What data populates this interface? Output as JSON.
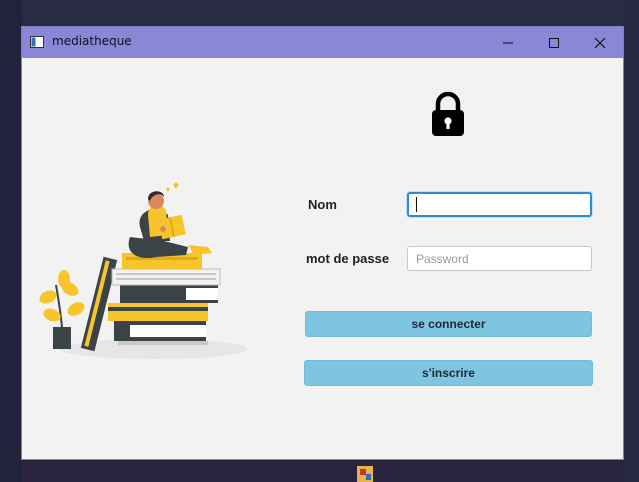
{
  "window": {
    "title": "mediatheque",
    "title_bar_color": "#8a87d6",
    "controls": [
      "minimize-icon",
      "maximize-icon",
      "close-icon"
    ]
  },
  "header_icon": "lock-icon",
  "illustration": "person-reading-on-books-illustration",
  "form": {
    "username_label": "Nom",
    "username_value": "",
    "password_label": "mot de passe",
    "password_placeholder": "Password"
  },
  "buttons": {
    "login_label": "se connecter",
    "register_label": "s'inscrire",
    "button_color": "#7ec5e2"
  }
}
